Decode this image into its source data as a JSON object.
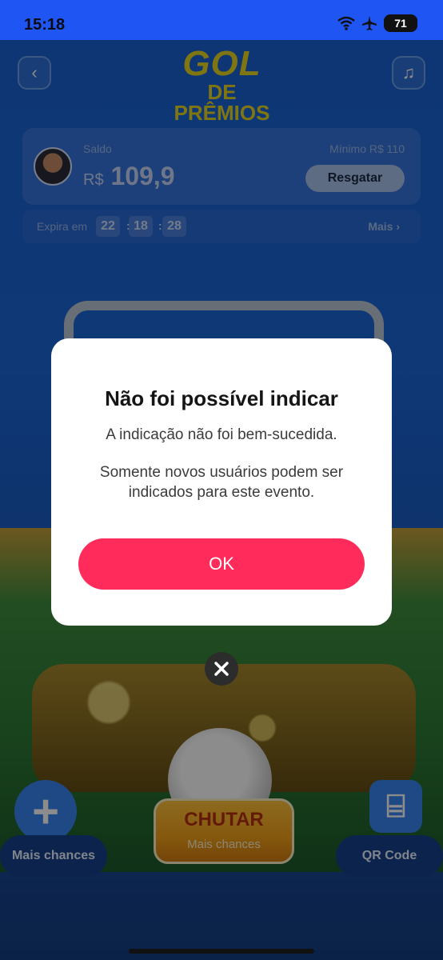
{
  "status_bar": {
    "time": "15:18",
    "battery": "71"
  },
  "header": {
    "logo_line1": "GOL",
    "logo_line2": "DE PRÊMIOS"
  },
  "balance": {
    "label": "Saldo",
    "currency": "R$",
    "amount": "109,9",
    "minimum_label": "Mínimo",
    "minimum_value": "R$ 110",
    "redeem_button": "Resgatar"
  },
  "expiry": {
    "label": "Expira em",
    "hours": "22",
    "minutes": "18",
    "seconds": "28",
    "more_link": "Mais ›"
  },
  "game": {
    "kick_button": "CHUTAR",
    "kick_sub": "Mais chances",
    "more_chances_button": "Mais chances",
    "qr_button": "QR Code"
  },
  "dialog": {
    "title": "Não foi possível indicar",
    "message1": "A indicação não foi bem-sucedida.",
    "message2": "Somente novos usuários podem ser indicados para este evento.",
    "ok_button": "OK"
  },
  "colors": {
    "accent": "#ff2b5b",
    "status_bar": "#1f55f2"
  }
}
